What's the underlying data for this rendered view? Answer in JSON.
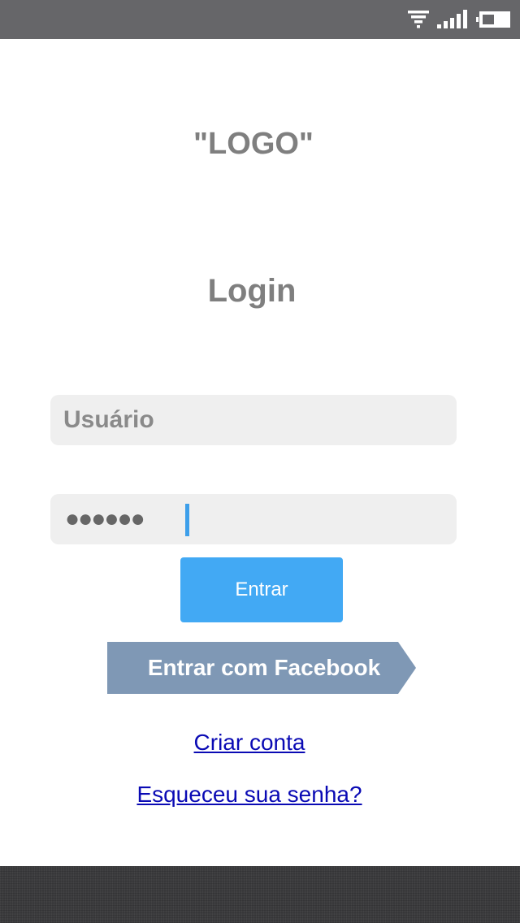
{
  "status_bar": {
    "icons": [
      "wifi-icon",
      "signal-icon",
      "battery-icon"
    ]
  },
  "logo": {
    "text": "\"LOGO\""
  },
  "login": {
    "title": "Login",
    "username_placeholder": "Usuário",
    "password_masked": "●●●●●●",
    "enter_label": "Entrar",
    "facebook_label": "Entrar com Facebook",
    "create_account_label": "Criar conta",
    "forgot_password_label": "Esqueceu sua senha?"
  },
  "colors": {
    "status_bar": "#666669",
    "input_background": "#efefef",
    "enter_button": "#42a9f4",
    "facebook_button": "#7f98b5",
    "link": "#0a0ab4",
    "heading_text": "#7f7f7f"
  }
}
